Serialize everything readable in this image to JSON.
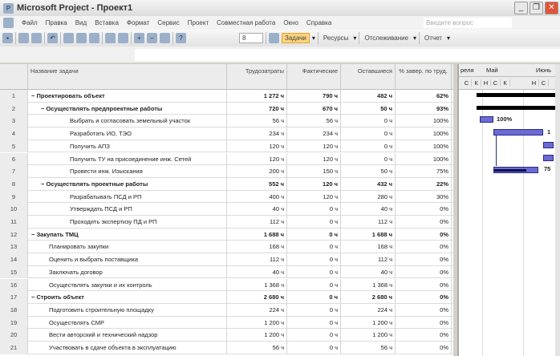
{
  "window": {
    "title": "Microsoft Project - Проект1"
  },
  "menu": [
    "Файл",
    "Правка",
    "Вид",
    "Вставка",
    "Формат",
    "Сервис",
    "Проект",
    "Совместная работа",
    "Окно",
    "Справка"
  ],
  "ask_placeholder": "Введите вопрос",
  "toolbar": {
    "font_size": "8",
    "tasks": "Задачи",
    "resources": "Ресурсы",
    "tracking": "Отслеживание",
    "report": "Отчет"
  },
  "columns": {
    "name": "Название задачи",
    "work": "Трудозатраты",
    "actual": "Фактические",
    "remaining": "Оставшиеся",
    "pct": "% завер. по труд."
  },
  "rows": [
    {
      "id": "1",
      "name": "Проектировать объект",
      "work": "1 272 ч",
      "actual": "790 ч",
      "remaining": "482 ч",
      "pct": "62%",
      "summary": true,
      "level": 0
    },
    {
      "id": "2",
      "name": "Осуществлять предпроектные работы",
      "work": "720 ч",
      "actual": "670 ч",
      "remaining": "50 ч",
      "pct": "93%",
      "summary": true,
      "level": 1
    },
    {
      "id": "3",
      "name": "Выбрать и согласовать земельный участок",
      "work": "56 ч",
      "actual": "56 ч",
      "remaining": "0 ч",
      "pct": "100%",
      "level": 2
    },
    {
      "id": "4",
      "name": "Разработать ИО, ТЭО",
      "work": "234 ч",
      "actual": "234 ч",
      "remaining": "0 ч",
      "pct": "100%",
      "level": 2
    },
    {
      "id": "5",
      "name": "Получить АПЗ",
      "work": "120 ч",
      "actual": "120 ч",
      "remaining": "0 ч",
      "pct": "100%",
      "level": 2
    },
    {
      "id": "6",
      "name": "Получить ТУ на присоединение инж. Сетей",
      "work": "120 ч",
      "actual": "120 ч",
      "remaining": "0 ч",
      "pct": "100%",
      "level": 2
    },
    {
      "id": "7",
      "name": "Провести инж. Изыскания",
      "work": "200 ч",
      "actual": "150 ч",
      "remaining": "50 ч",
      "pct": "75%",
      "level": 2
    },
    {
      "id": "8",
      "name": "Осуществлять проектные работы",
      "work": "552 ч",
      "actual": "120 ч",
      "remaining": "432 ч",
      "pct": "22%",
      "summary": true,
      "level": 1
    },
    {
      "id": "9",
      "name": "Разрабатывать ПСД и РП",
      "work": "400 ч",
      "actual": "120 ч",
      "remaining": "280 ч",
      "pct": "30%",
      "level": 2
    },
    {
      "id": "10",
      "name": "Утверждать ПСД и РП",
      "work": "40 ч",
      "actual": "0 ч",
      "remaining": "40 ч",
      "pct": "0%",
      "level": 2
    },
    {
      "id": "11",
      "name": "Проходить экспертизу ПД и РП",
      "work": "112 ч",
      "actual": "0 ч",
      "remaining": "112 ч",
      "pct": "0%",
      "level": 2
    },
    {
      "id": "12",
      "name": "Закупать ТМЦ",
      "work": "1 688 ч",
      "actual": "0 ч",
      "remaining": "1 688 ч",
      "pct": "0%",
      "summary": true,
      "level": 0
    },
    {
      "id": "13",
      "name": "Планировать закупки",
      "work": "168 ч",
      "actual": "0 ч",
      "remaining": "168 ч",
      "pct": "0%",
      "level": 1
    },
    {
      "id": "14",
      "name": "Оценить и выбрать поставщика",
      "work": "112 ч",
      "actual": "0 ч",
      "remaining": "112 ч",
      "pct": "0%",
      "level": 1
    },
    {
      "id": "15",
      "name": "Заключать договор",
      "work": "40 ч",
      "actual": "0 ч",
      "remaining": "40 ч",
      "pct": "0%",
      "level": 1
    },
    {
      "id": "16",
      "name": "Осуществлять закупки и их контроль",
      "work": "1 368 ч",
      "actual": "0 ч",
      "remaining": "1 368 ч",
      "pct": "0%",
      "level": 1
    },
    {
      "id": "17",
      "name": "Строить объект",
      "work": "2 680 ч",
      "actual": "0 ч",
      "remaining": "2 680 ч",
      "pct": "0%",
      "summary": true,
      "level": 0
    },
    {
      "id": "18",
      "name": "Подготовить строительную площадку",
      "work": "224 ч",
      "actual": "0 ч",
      "remaining": "224 ч",
      "pct": "0%",
      "level": 1
    },
    {
      "id": "19",
      "name": "Осуществлять СМР",
      "work": "1 200 ч",
      "actual": "0 ч",
      "remaining": "1 200 ч",
      "pct": "0%",
      "level": 1
    },
    {
      "id": "20",
      "name": "Вести авторский и технический надзор",
      "work": "1 200 ч",
      "actual": "0 ч",
      "remaining": "1 200 ч",
      "pct": "0%",
      "level": 1
    },
    {
      "id": "21",
      "name": "Участвовать в сдаче объекта в эксплуатацию",
      "work": "56 ч",
      "actual": "0 ч",
      "remaining": "56 ч",
      "pct": "0%",
      "level": 1
    }
  ],
  "gantt": {
    "months": [
      "реля",
      "Май",
      "Июнь"
    ],
    "days": [
      "С",
      "К",
      "Н",
      "С",
      "К",
      "Н",
      "С"
    ],
    "labels": {
      "task3": "100%",
      "task4": "1",
      "task7": "75"
    },
    "bar_color": "#6b6bd6"
  }
}
